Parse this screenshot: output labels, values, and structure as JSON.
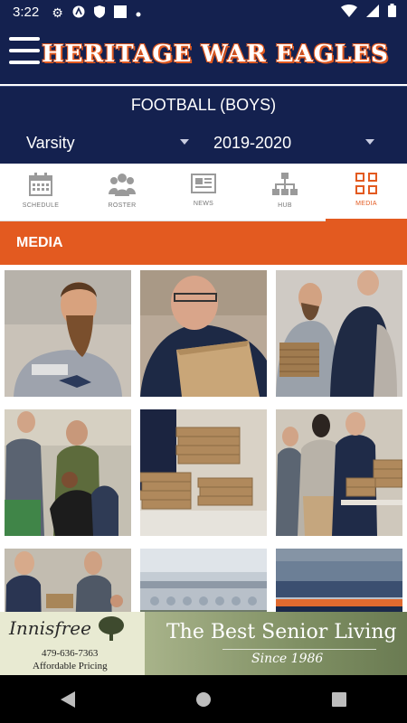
{
  "status_bar": {
    "time": "3:22",
    "icons": [
      "gear-icon",
      "app-a-icon",
      "shield-icon",
      "square-icon",
      "dot-icon",
      "wifi-icon",
      "signal-icon",
      "battery-icon"
    ]
  },
  "header": {
    "title": "HERITAGE WAR EAGLES",
    "menu_icon": "hamburger-icon"
  },
  "team": {
    "sport": "FOOTBALL (BOYS)",
    "level": "Varsity",
    "season": "2019-2020"
  },
  "tabs": [
    {
      "label": "SCHEDULE",
      "icon": "calendar-icon",
      "active": false
    },
    {
      "label": "ROSTER",
      "icon": "people-icon",
      "active": false
    },
    {
      "label": "NEWS",
      "icon": "newspaper-icon",
      "active": false
    },
    {
      "label": "HUB",
      "icon": "hierarchy-icon",
      "active": false
    },
    {
      "label": "MEDIA",
      "icon": "grid-icon",
      "active": true
    }
  ],
  "section": {
    "title": "MEDIA"
  },
  "media": {
    "items": [
      "photo-1",
      "photo-2",
      "photo-3",
      "photo-4",
      "photo-5",
      "photo-6",
      "photo-7",
      "photo-8",
      "photo-9"
    ]
  },
  "ad": {
    "brand": "Innisfree",
    "phone": "479-636-7363",
    "tagline": "Affordable Pricing",
    "headline": "The Best Senior Living",
    "since": "Since 1986"
  },
  "colors": {
    "navy": "#14214f",
    "accent": "#e35a20"
  }
}
